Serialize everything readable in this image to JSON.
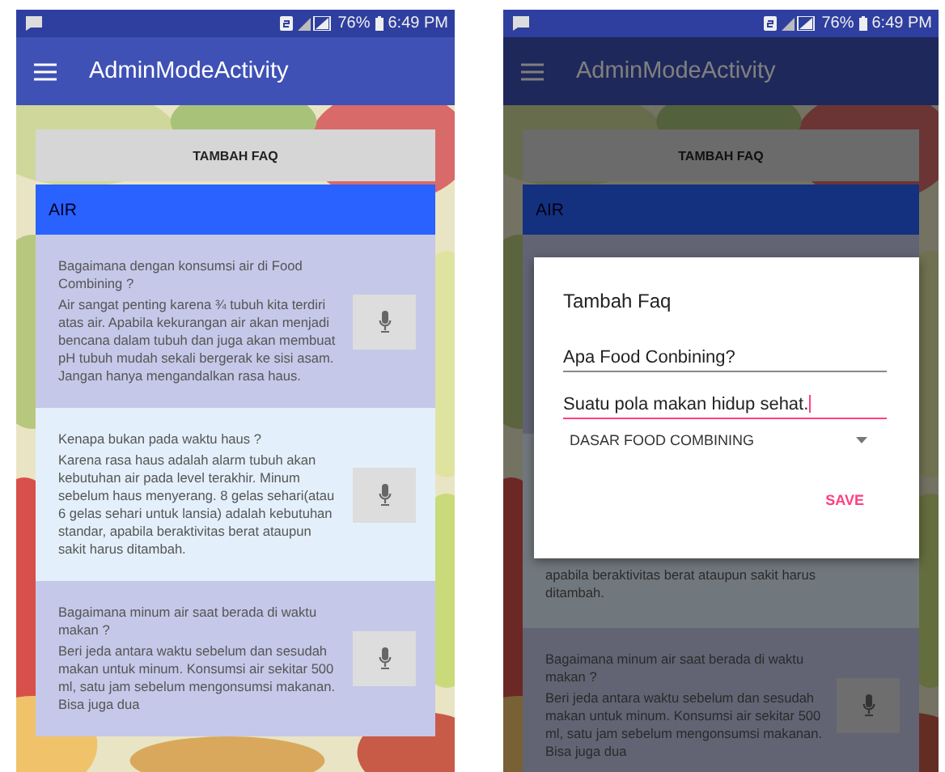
{
  "screens": [
    {
      "status_bar": {
        "battery": "76%",
        "time": "6:49 PM"
      },
      "app_bar": {
        "title": "AdminModeActivity"
      },
      "add_button": "TAMBAH FAQ",
      "category": "AIR",
      "dimmed": false,
      "faqs": [
        {
          "question": "Bagaimana dengan konsumsi air di Food Combining ?",
          "answer": "Air sangat penting karena ¾ tubuh kita terdiri atas air. Apabila kekurangan air akan menjadi bencana dalam tubuh dan juga akan membuat pH tubuh mudah sekali bergerak ke sisi asam. Jangan hanya mengandalkan rasa haus.",
          "mic": true
        },
        {
          "question": "Kenapa bukan pada waktu haus ?",
          "answer": "Karena rasa haus adalah alarm tubuh akan kebutuhan air pada level terakhir. Minum sebelum haus menyerang. 8 gelas sehari(atau 6 gelas sehari untuk lansia) adalah kebutuhan standar, apabila beraktivitas berat ataupun sakit harus ditambah.",
          "mic": true
        },
        {
          "question": "Bagaimana minum air saat berada di waktu makan ?",
          "answer": "Beri jeda antara waktu sebelum dan sesudah makan untuk minum. Konsumsi air sekitar 500 ml, satu jam sebelum mengonsumsi makanan. Bisa juga dua",
          "mic": true
        }
      ]
    },
    {
      "status_bar": {
        "battery": "76%",
        "time": "6:49 PM"
      },
      "app_bar": {
        "title": "AdminModeActivity"
      },
      "add_button": "TAMBAH FAQ",
      "category": "AIR",
      "dimmed": true,
      "faqs": [
        {
          "mic": false
        },
        {
          "answer": "apabila beraktivitas berat ataupun sakit harus ditambah.",
          "mic": false
        },
        {
          "question": "Bagaimana minum air saat berada di waktu makan ?",
          "answer": "Beri jeda antara waktu sebelum dan sesudah makan untuk minum. Konsumsi air sekitar 500 ml, satu jam sebelum mengonsumsi makanan. Bisa juga dua",
          "mic": true
        }
      ],
      "dialog": {
        "title": "Tambah Faq",
        "fields": [
          {
            "value": "Apa Food Conbining?",
            "focused": false
          },
          {
            "value": "Suatu pola makan hidup sehat.",
            "focused": true
          }
        ],
        "dropdown": "DASAR FOOD COMBINING",
        "save_button": "SAVE"
      }
    }
  ]
}
